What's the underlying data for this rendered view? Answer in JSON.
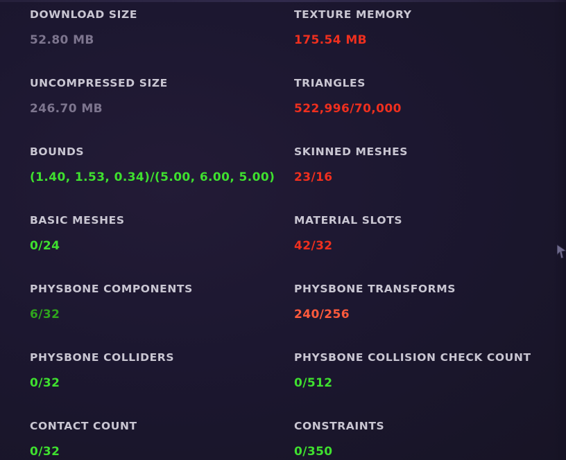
{
  "stats": {
    "download_size": {
      "label": "DOWNLOAD SIZE",
      "value": "52.80 MB",
      "status": "neutral",
      "color": "#7d758e"
    },
    "texture_memory": {
      "label": "TEXTURE MEMORY",
      "value": "175.54 MB",
      "status": "bad",
      "color": "#ef2f1e"
    },
    "uncompressed_size": {
      "label": "UNCOMPRESSED SIZE",
      "value": "246.70 MB",
      "status": "neutral",
      "color": "#7d758e"
    },
    "triangles": {
      "label": "TRIANGLES",
      "value": "522,996/70,000",
      "status": "bad",
      "color": "#ef2f1e"
    },
    "bounds": {
      "label": "BOUNDS",
      "value": "(1.40, 1.53, 0.34)/(5.00, 6.00, 5.00)",
      "status": "good",
      "color": "#3fe02f"
    },
    "skinned_meshes": {
      "label": "SKINNED MESHES",
      "value": "23/16",
      "status": "bad",
      "color": "#ef2f1e"
    },
    "basic_meshes": {
      "label": "BASIC MESHES",
      "value": "0/24",
      "status": "good",
      "color": "#3fe02f"
    },
    "material_slots": {
      "label": "MATERIAL SLOTS",
      "value": "42/32",
      "status": "bad",
      "color": "#ef2f1e"
    },
    "physbone_components": {
      "label": "PHYSBONE COMPONENTS",
      "value": "6/32",
      "status": "good",
      "color": "#2fa61d"
    },
    "physbone_transforms": {
      "label": "PHYSBONE TRANSFORMS",
      "value": "240/256",
      "status": "warning",
      "color": "#ff5a3c"
    },
    "physbone_colliders": {
      "label": "PHYSBONE COLLIDERS",
      "value": "0/32",
      "status": "good",
      "color": "#3fe02f"
    },
    "physbone_collision_check_count": {
      "label": "PHYSBONE COLLISION CHECK COUNT",
      "value": "0/512",
      "status": "good",
      "color": "#3fe02f"
    },
    "contact_count": {
      "label": "CONTACT COUNT",
      "value": "0/32",
      "status": "good",
      "color": "#3fe02f"
    },
    "constraints": {
      "label": "CONSTRAINTS",
      "value": "0/350",
      "status": "good",
      "color": "#3fe02f"
    }
  },
  "colors": {
    "background": "#1c1730",
    "label": "#c9c6d2"
  },
  "cursor": {
    "icon": "mouse-pointer-icon"
  }
}
